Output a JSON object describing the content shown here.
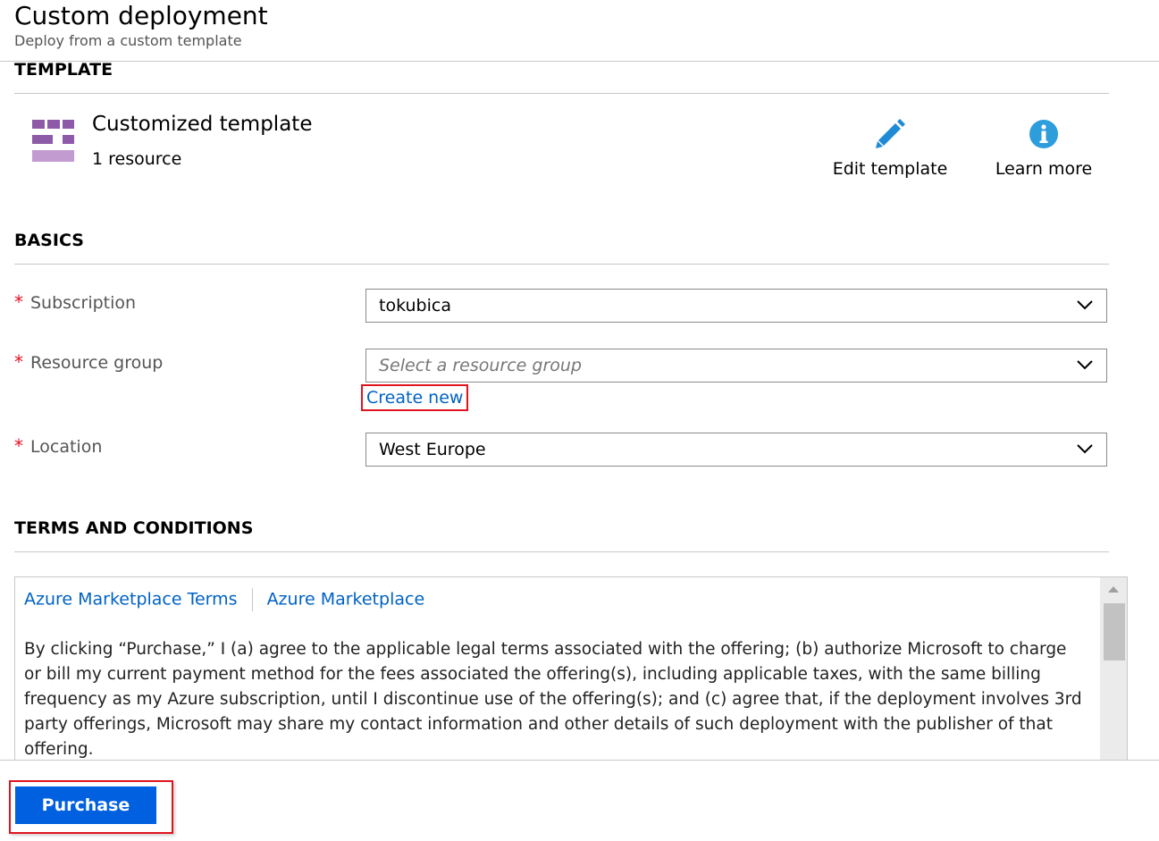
{
  "header": {
    "title": "Custom deployment",
    "subtitle": "Deploy from a custom template"
  },
  "template": {
    "section_title": "TEMPLATE",
    "name": "Customized template",
    "resource_count": "1 resource",
    "icon": "template-grid-icon",
    "actions": {
      "edit_label": "Edit template",
      "edit_icon": "pencil-icon",
      "learn_label": "Learn more",
      "learn_icon": "info-icon"
    }
  },
  "basics": {
    "section_title": "BASICS",
    "required_mark": "*",
    "subscription": {
      "label": "Subscription",
      "value": "tokubica"
    },
    "resource_group": {
      "label": "Resource group",
      "placeholder": "Select a resource group",
      "create_new": "Create new"
    },
    "location": {
      "label": "Location",
      "value": "West Europe"
    }
  },
  "terms": {
    "section_title": "TERMS AND CONDITIONS",
    "links": [
      "Azure Marketplace Terms",
      "Azure Marketplace"
    ],
    "text": "By clicking “Purchase,” I (a) agree to the applicable legal terms associated with the offering; (b) authorize Microsoft to charge or bill my current payment method for the fees associated the offering(s), including applicable taxes, with the same billing frequency as my Azure subscription, until I discontinue use of the offering(s); and (c) agree that, if the deployment involves 3rd party offerings, Microsoft may share my contact information and other details of such deployment with the publisher of that offering."
  },
  "footer": {
    "purchase_label": "Purchase"
  },
  "colors": {
    "accent": "#0060df",
    "link": "#0062c4",
    "required": "#e81123",
    "highlight_border": "#e0141f",
    "template_icon": "#8c5aa6"
  }
}
